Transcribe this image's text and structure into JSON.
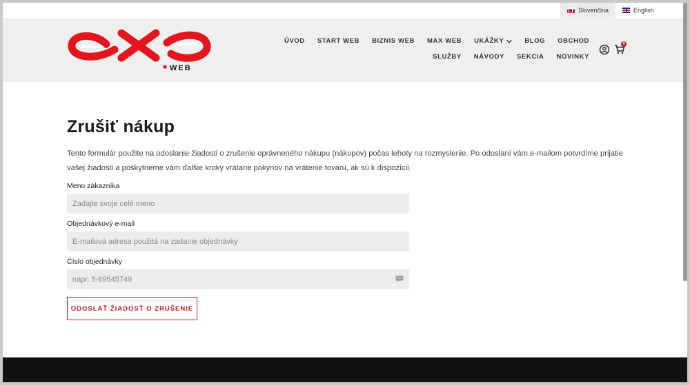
{
  "languages": [
    {
      "label": "Slovenčina",
      "flag": "sk-flag-icon",
      "active": true
    },
    {
      "label": "English",
      "flag": "uk-flag-icon",
      "active": false
    }
  ],
  "logo": {
    "sub": "WEB",
    "color": "#e3161d"
  },
  "nav": {
    "row1": [
      "ÚVOD",
      "START WEB",
      "BIZNIS WEB",
      "MAX WEB",
      "UKÁŽKY",
      "BLOG",
      "OBCHOD",
      "SLUŽBY"
    ],
    "row2": [
      "NÁVODY",
      "SEKCIA",
      "NOVINKY"
    ],
    "cart_count": "0"
  },
  "page": {
    "title": "Zrušiť nákup",
    "intro": "Tento formulár použite na odoslanie žiadosti o zrušenie oprávneného nákupu (nákupov) počas lehoty na rozmyslenie. Po odoslaní vám e-mailom potvrdíme prijatie vašej žiadosti a poskytneme vám ďalšie kroky vrátane pokynov na vrátenie tovaru, ak sú k dispozícii."
  },
  "form": {
    "name_label": "Meno zákazníka",
    "name_placeholder": "Zadajte svoje celé meno",
    "email_label": "Objednávkový e-mail",
    "email_placeholder": "E-mailová adresa použitá na zadanie objednávky",
    "order_label": "Číslo objednávky",
    "order_placeholder": "napr. 5-69545749",
    "submit_label": "ODOSLAŤ ŽIADOSŤ O ZRUŠENIE"
  },
  "colors": {
    "accent": "#d0161d",
    "header_bg": "#efefef",
    "field_bg": "#ececec",
    "footer_bg": "#111111"
  }
}
